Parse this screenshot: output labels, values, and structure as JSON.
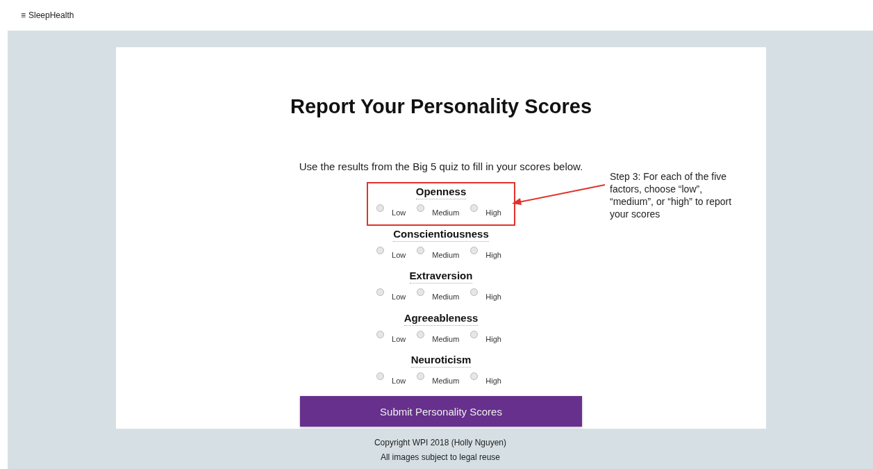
{
  "nav": {
    "menu_icon": "≡",
    "brand": "SleepHealth"
  },
  "title": "Report Your Personality Scores",
  "instructions": "Use the results from the Big 5 quiz to fill in your scores below.",
  "factors": [
    {
      "name": "Openness",
      "highlighted": true,
      "options": [
        {
          "label": "Low",
          "selected": false
        },
        {
          "label": "Medium",
          "selected": false
        },
        {
          "label": "High",
          "selected": false
        }
      ]
    },
    {
      "name": "Conscientiousness",
      "highlighted": false,
      "options": [
        {
          "label": "Low",
          "selected": false
        },
        {
          "label": "Medium",
          "selected": false
        },
        {
          "label": "High",
          "selected": false
        }
      ]
    },
    {
      "name": "Extraversion",
      "highlighted": false,
      "options": [
        {
          "label": "Low",
          "selected": false
        },
        {
          "label": "Medium",
          "selected": false
        },
        {
          "label": "High",
          "selected": false
        }
      ]
    },
    {
      "name": "Agreeableness",
      "highlighted": false,
      "options": [
        {
          "label": "Low",
          "selected": false
        },
        {
          "label": "Medium",
          "selected": false
        },
        {
          "label": "High",
          "selected": false
        }
      ]
    },
    {
      "name": "Neuroticism",
      "highlighted": false,
      "options": [
        {
          "label": "Low",
          "selected": false
        },
        {
          "label": "Medium",
          "selected": false
        },
        {
          "label": "High",
          "selected": false
        }
      ]
    }
  ],
  "annotation": "Step 3: For each of the five factors, choose “low”, “medium”, or “high” to report your scores",
  "submit_button": "Submit Personality Scores",
  "footer": [
    "Copyright WPI 2018 (Holly Nguyen)",
    "All images subject to legal reuse"
  ]
}
